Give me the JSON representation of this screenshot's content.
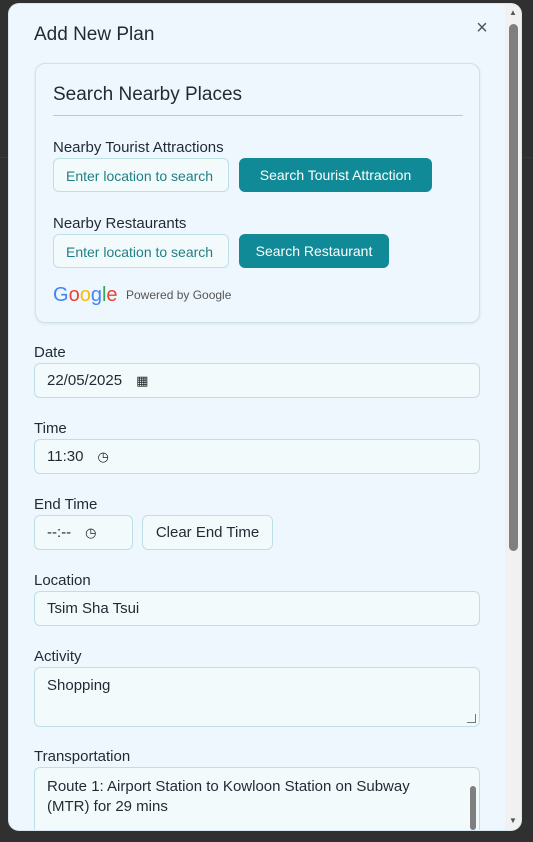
{
  "modal": {
    "title": "Add New Plan",
    "close_label": "×"
  },
  "search_card": {
    "title": "Search Nearby Places",
    "attractions": {
      "label": "Nearby Tourist Attractions",
      "placeholder": "Enter location to search",
      "button": "Search Tourist Attraction"
    },
    "restaurants": {
      "label": "Nearby Restaurants",
      "placeholder": "Enter location to search",
      "button": "Search Restaurant"
    },
    "attribution": {
      "logo": [
        "G",
        "o",
        "o",
        "g",
        "l",
        "e"
      ],
      "text": "Powered by Google"
    }
  },
  "form": {
    "date": {
      "label": "Date",
      "value": "22/05/2025"
    },
    "time": {
      "label": "Time",
      "value": "11:30"
    },
    "end_time": {
      "label": "End Time",
      "value": "--:--",
      "clear_button": "Clear End Time"
    },
    "location": {
      "label": "Location",
      "value": "Tsim Sha Tsui"
    },
    "activity": {
      "label": "Activity",
      "value": "Shopping"
    },
    "transportation": {
      "label": "Transportation",
      "value": "Route 1: Airport Station to Kowloon Station on Subway  (MTR) for 29 mins"
    }
  },
  "icons": {
    "close": "close-icon",
    "calendar": "calendar-icon",
    "clock": "clock-icon"
  },
  "colors": {
    "accent": "#0f8a96",
    "panel": "#eef7fd"
  }
}
